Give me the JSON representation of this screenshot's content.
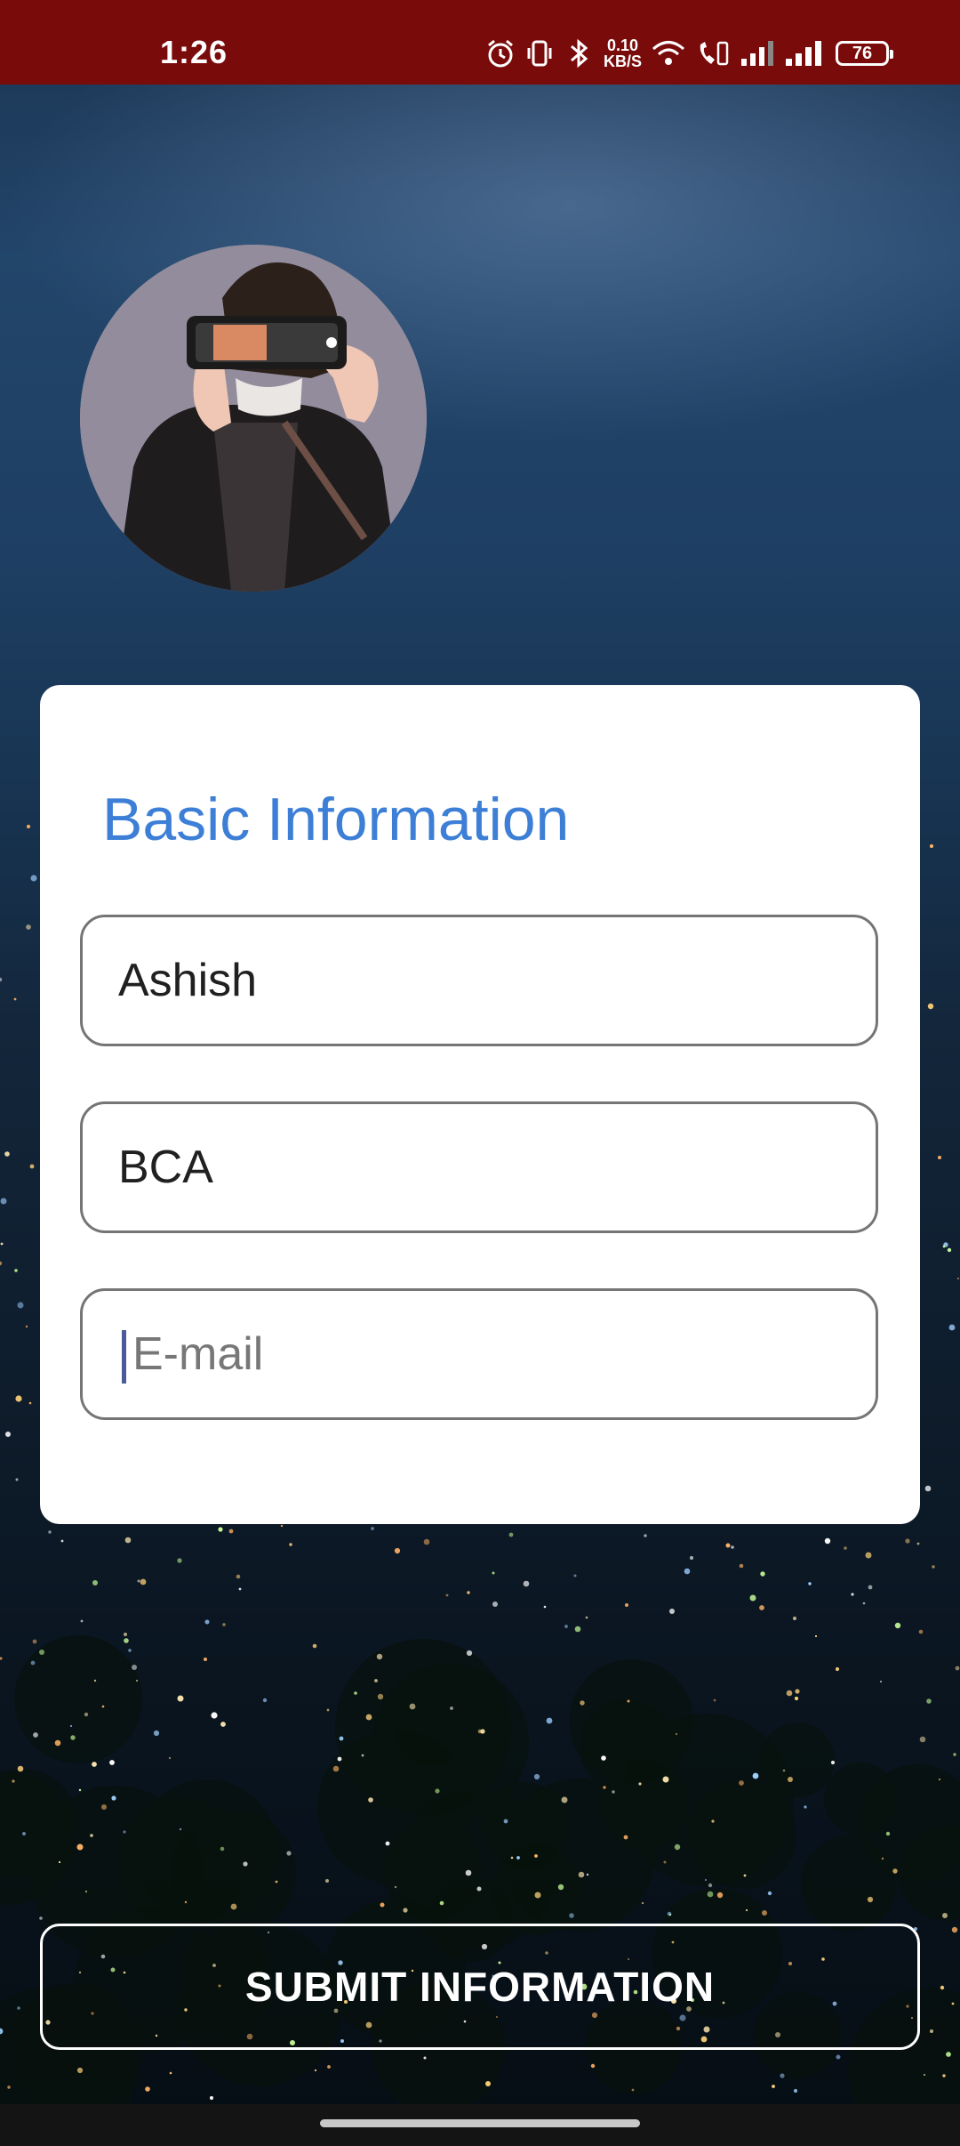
{
  "status_bar": {
    "time": "1:26",
    "network_speed_value": "0.10",
    "network_speed_unit": "KB/S",
    "battery": "76"
  },
  "profile": {
    "avatar_icon": "person-with-camera-avatar"
  },
  "form": {
    "title": "Basic Information",
    "name_value": "Ashish",
    "course_value": "BCA",
    "email_value": "",
    "email_placeholder": "E-mail",
    "accent_color": "#3d7fd6"
  },
  "actions": {
    "submit_label": "SUBMIT INFORMATION"
  }
}
